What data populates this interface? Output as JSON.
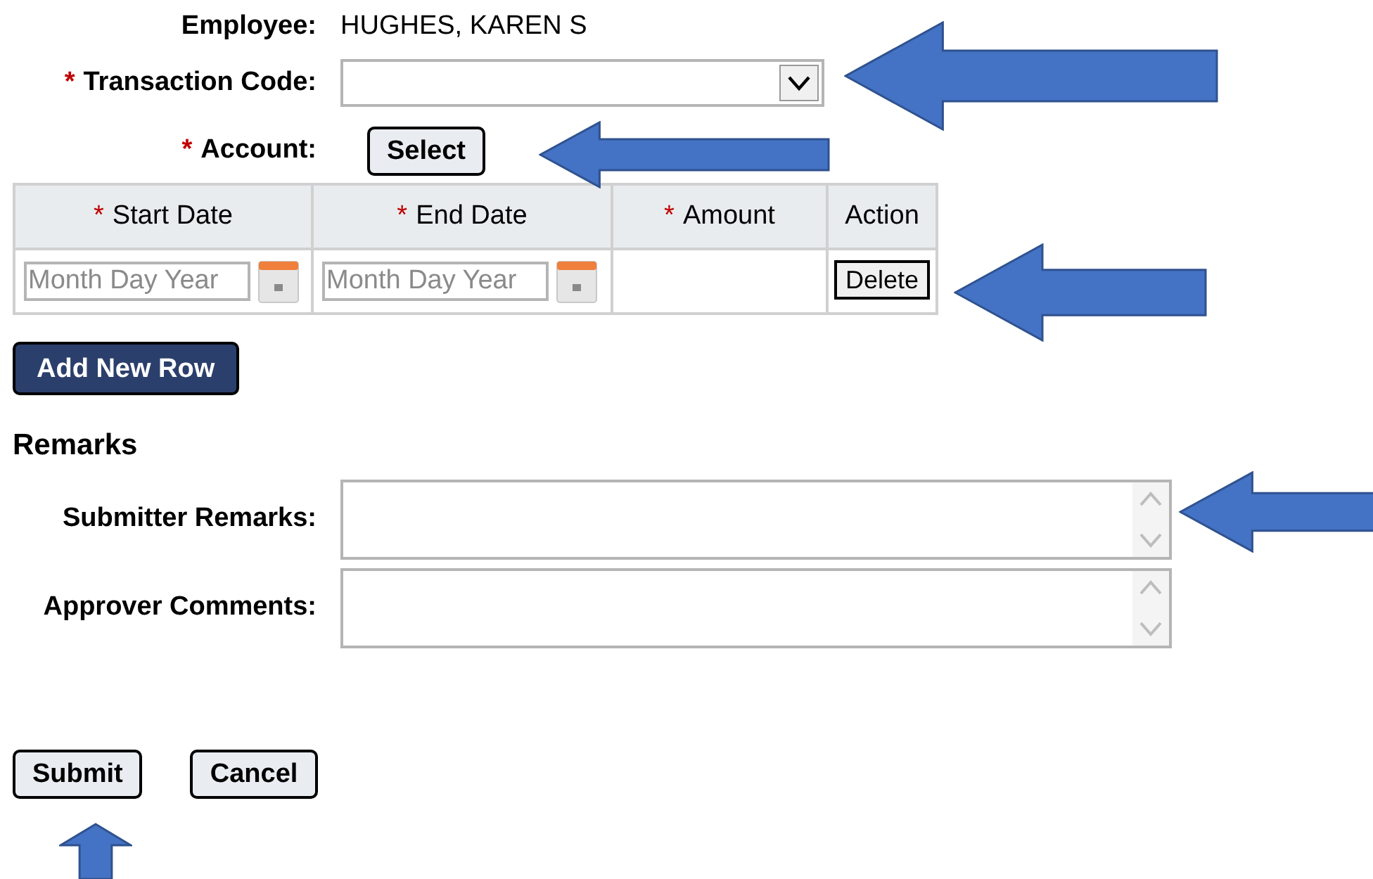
{
  "employee": {
    "label": "Employee:",
    "value": "HUGHES, KAREN S"
  },
  "transaction_code": {
    "label": "Transaction Code:",
    "required_mark": "*"
  },
  "account": {
    "label": "Account:",
    "required_mark": "*",
    "button": "Select"
  },
  "table": {
    "columns": [
      {
        "label": "Start Date",
        "required_mark": "*"
      },
      {
        "label": "End Date",
        "required_mark": "*"
      },
      {
        "label": "Amount",
        "required_mark": "*"
      },
      {
        "label": "Action"
      }
    ],
    "rows": [
      {
        "start_date": {
          "placeholder": "Month Day Year"
        },
        "end_date": {
          "placeholder": "Month Day Year"
        },
        "action": "Delete"
      }
    ]
  },
  "add_row_button": "Add New Row",
  "remarks": {
    "heading": "Remarks",
    "fields": [
      {
        "label": "Submitter Remarks:"
      },
      {
        "label": "Approver Comments:"
      }
    ]
  },
  "buttons": [
    "Submit",
    "Cancel"
  ]
}
